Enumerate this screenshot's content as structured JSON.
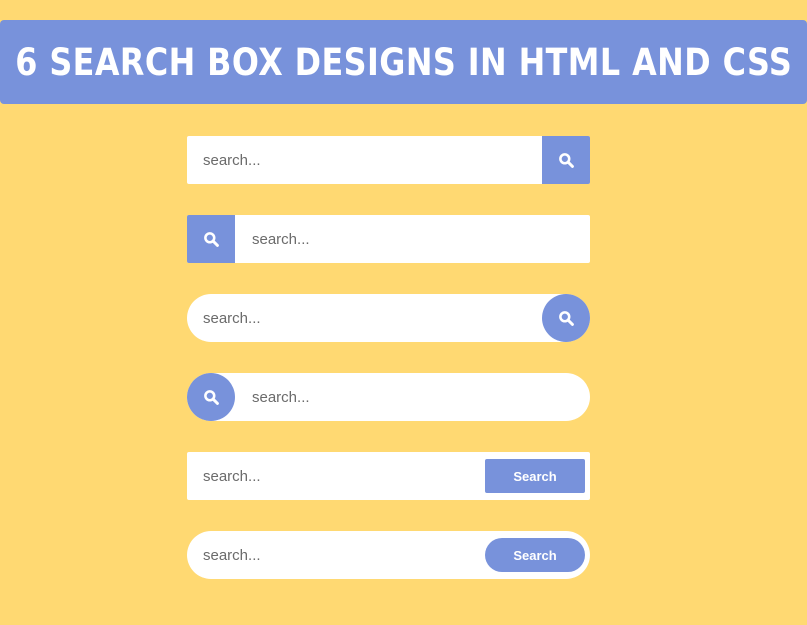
{
  "header": {
    "title": "6 SEARCH BOX DESIGNS IN HTML AND CSS"
  },
  "colors": {
    "background": "#FFD972",
    "accent": "#7892DB",
    "box": "#FFFFFF",
    "placeholder": "#6B6B6B"
  },
  "search_boxes": [
    {
      "style": "square, icon button right",
      "placeholder": "search...",
      "value": "",
      "button_icon": "search-icon"
    },
    {
      "style": "square, icon button left",
      "placeholder": "search...",
      "value": "",
      "button_icon": "search-icon"
    },
    {
      "style": "rounded, circular icon button right",
      "placeholder": "search...",
      "value": "",
      "button_icon": "search-icon"
    },
    {
      "style": "rounded, circular icon button left",
      "placeholder": "search...",
      "value": "",
      "button_icon": "search-icon"
    },
    {
      "style": "square, text button right",
      "placeholder": "search...",
      "value": "",
      "button_label": "Search"
    },
    {
      "style": "rounded, pill text button right",
      "placeholder": "search...",
      "value": "",
      "button_label": "Search"
    }
  ]
}
